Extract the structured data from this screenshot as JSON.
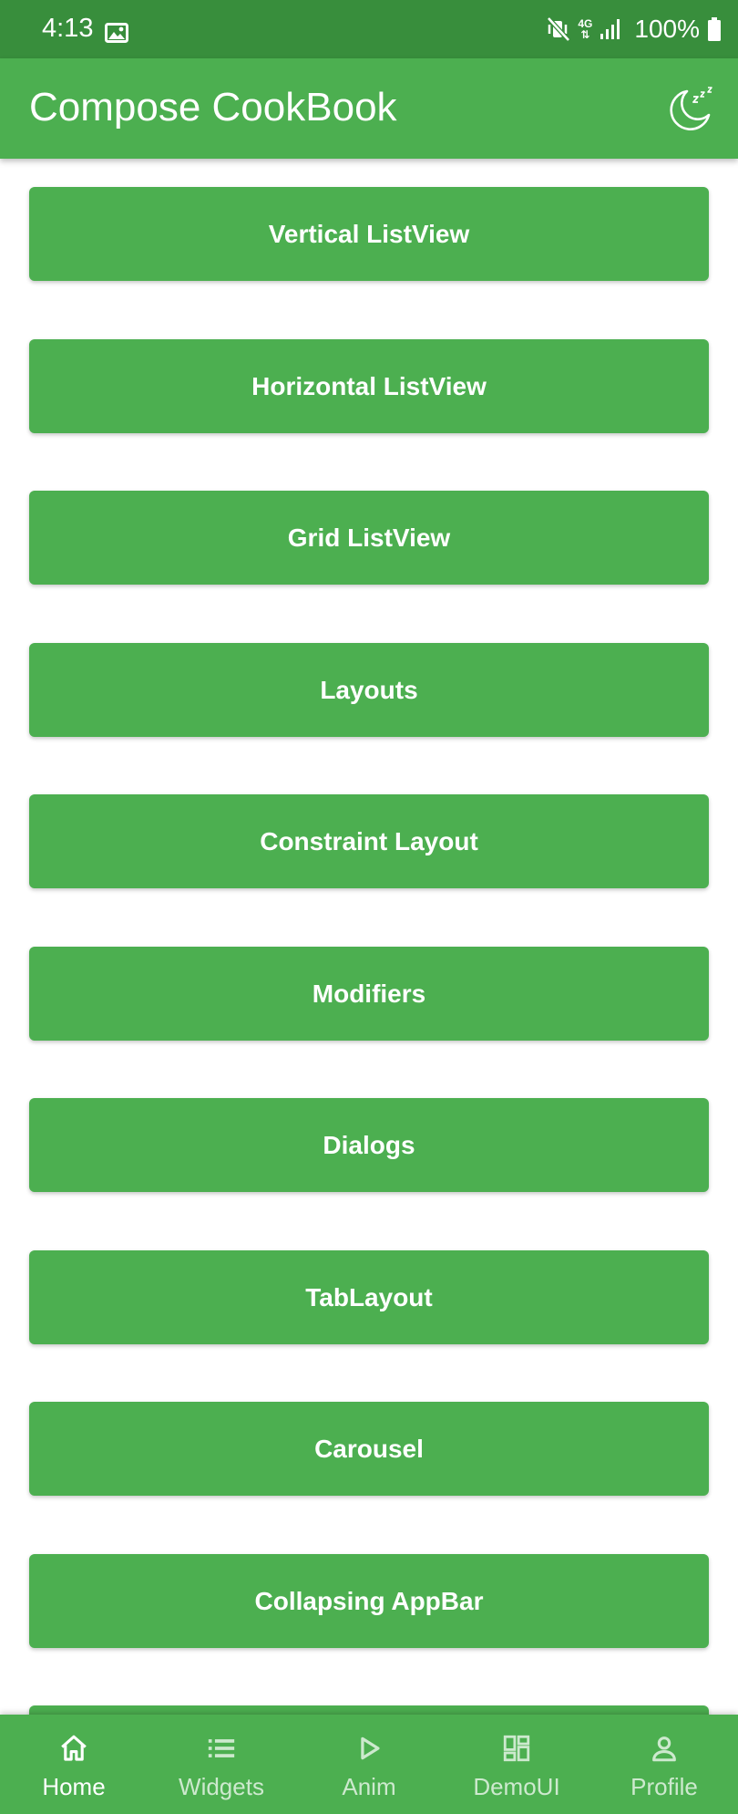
{
  "status_bar": {
    "time": "4:13",
    "network": "4G",
    "battery": "100%"
  },
  "app_bar": {
    "title": "Compose CookBook"
  },
  "menu": {
    "items": [
      "Vertical ListView",
      "Horizontal ListView",
      "Grid ListView",
      "Layouts",
      "Constraint Layout",
      "Modifiers",
      "Dialogs",
      "TabLayout",
      "Carousel",
      "Collapsing AppBar"
    ]
  },
  "bottom_nav": {
    "items": [
      {
        "label": "Home",
        "icon": "home-icon",
        "selected": true
      },
      {
        "label": "Widgets",
        "icon": "list-icon",
        "selected": false
      },
      {
        "label": "Anim",
        "icon": "play-icon",
        "selected": false
      },
      {
        "label": "DemoUI",
        "icon": "dashboard-icon",
        "selected": false
      },
      {
        "label": "Profile",
        "icon": "person-icon",
        "selected": false
      }
    ]
  },
  "colors": {
    "primary": "#4CAF50",
    "primary_dark": "#388E3C",
    "on_primary": "#FFFFFF",
    "background": "#FFFFFF"
  }
}
